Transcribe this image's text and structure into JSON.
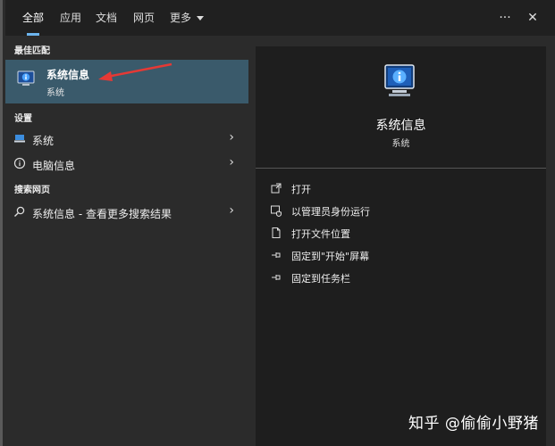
{
  "colors": {
    "accent": "#6cb4ee",
    "best_bg": "#3a5a6b",
    "panel_dark": "#1e1e1e",
    "panel": "#2b2b2b",
    "arrow": "#e53935"
  },
  "topbar": {
    "tabs": [
      {
        "label": "全部",
        "active": true
      },
      {
        "label": "应用"
      },
      {
        "label": "文档"
      },
      {
        "label": "网页"
      },
      {
        "label": "更多"
      }
    ],
    "more_icon": "ellipsis-icon",
    "close_icon": "close-icon",
    "ellipsis": "···",
    "close": "✕"
  },
  "left": {
    "best_match_header": "最佳匹配",
    "best_match": {
      "title": "系统信息",
      "subtitle": "系统"
    },
    "settings_header": "设置",
    "settings_items": [
      {
        "label": "系统",
        "icon": "laptop-icon"
      },
      {
        "label": "电脑信息",
        "icon": "info-icon"
      }
    ],
    "web_header": "搜索网页",
    "web_item": {
      "label": "系统信息 - 查看更多搜索结果",
      "icon": "search-icon"
    }
  },
  "right": {
    "app_title": "系统信息",
    "app_subtitle": "系统",
    "actions": [
      {
        "label": "打开",
        "icon": "open-icon"
      },
      {
        "label": "以管理员身份运行",
        "icon": "admin-shield-icon"
      },
      {
        "label": "打开文件位置",
        "icon": "file-location-icon"
      },
      {
        "label": "固定到\"开始\"屏幕",
        "icon": "pin-icon"
      },
      {
        "label": "固定到任务栏",
        "icon": "pin-icon"
      }
    ]
  },
  "watermark": "知乎 @偷偷小野猪"
}
